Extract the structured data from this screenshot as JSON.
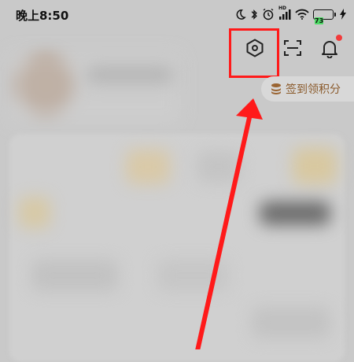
{
  "status_bar": {
    "time": "晚上8:50",
    "icons": [
      "moon-icon",
      "bluetooth-icon",
      "alarm-icon",
      "signal-icon",
      "wifi-icon",
      "battery-icon",
      "charging-icon"
    ],
    "signal_label": "HD",
    "battery_level": "73"
  },
  "header": {
    "icons": [
      "settings-hexagon-icon",
      "scan-icon",
      "bell-icon"
    ]
  },
  "signin": {
    "label": "签到领积分",
    "icon": "coin-stack-icon"
  },
  "colors": {
    "highlight": "#ff1a1a",
    "signin_text": "#8a5a2b",
    "notification_dot": "#f23b3b",
    "battery_fill": "#4cd964"
  }
}
